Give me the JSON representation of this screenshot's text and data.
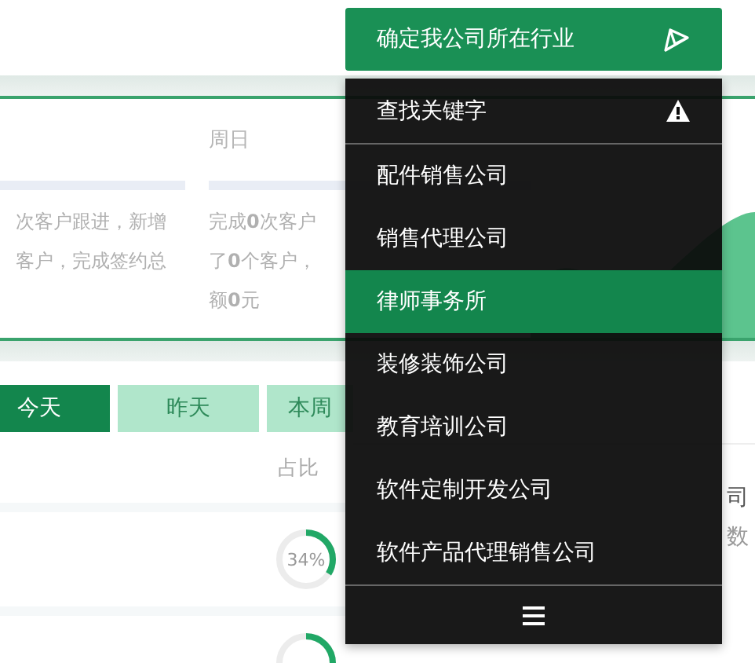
{
  "header_button": {
    "label": "确定我公司所在行业"
  },
  "week_card": {
    "column_1": {
      "lines": [
        "次客户跟进，新增",
        "客户，完成签约总"
      ]
    },
    "column_2": {
      "heading": "周日",
      "lines": [
        "完成**0**次客户",
        "了**0**个客户，",
        "额**0**元"
      ]
    }
  },
  "period_tabs": [
    {
      "label": "今天",
      "selected": true
    },
    {
      "label": "昨天",
      "selected": false
    },
    {
      "label": "本周",
      "selected": false
    }
  ],
  "share_table": {
    "header": "占比",
    "rows": [
      {
        "label": "34%",
        "level": 0.34
      },
      {
        "level": 0.25
      }
    ]
  },
  "sales_panel": {
    "fragments": [
      "司",
      "数"
    ]
  },
  "industry_menu": {
    "search": {
      "label": "查找关键字"
    },
    "items": [
      {
        "label": "配件销售公司",
        "selected": false
      },
      {
        "label": "销售代理公司",
        "selected": false
      },
      {
        "label": "律师事务所",
        "selected": true
      },
      {
        "label": "装修装饰公司",
        "selected": false
      },
      {
        "label": "教育培训公司",
        "selected": false
      },
      {
        "label": "软件定制开发公司",
        "selected": false
      },
      {
        "label": "软件产品代理销售公司",
        "selected": false
      }
    ]
  }
}
